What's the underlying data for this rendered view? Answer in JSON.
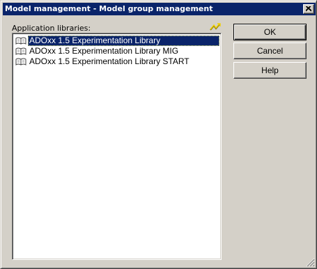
{
  "window": {
    "title": "Model management - Model group management"
  },
  "libraries": {
    "label": "Application libraries:",
    "selected_index": 0,
    "items": [
      {
        "label": "ADOxx 1.5 Experimentation Library",
        "icon": "book-icon"
      },
      {
        "label": "ADOxx 1.5 Experimentation Library MIG",
        "icon": "book-icon"
      },
      {
        "label": "ADOxx 1.5 Experimentation Library START",
        "icon": "book-icon"
      }
    ]
  },
  "buttons": {
    "ok_label": "OK",
    "cancel_label": "Cancel",
    "help_label": "Help"
  },
  "colors": {
    "titlebar": "#0a246a",
    "selection": "#0a246a",
    "dialog_face": "#d4d0c8"
  }
}
